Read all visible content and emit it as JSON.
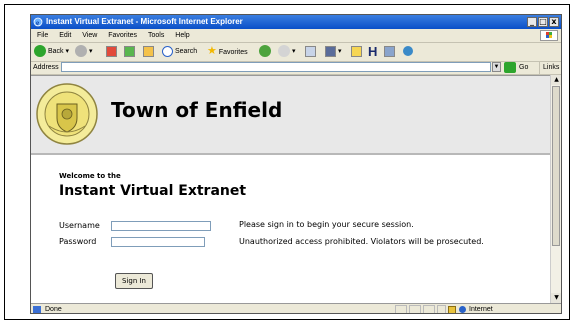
{
  "window": {
    "title": "Instant Virtual Extranet - Microsoft Internet Explorer"
  },
  "menu": {
    "items": [
      "File",
      "Edit",
      "View",
      "Favorites",
      "Tools",
      "Help"
    ]
  },
  "toolbar": {
    "back": "Back",
    "search": "Search",
    "favorites": "Favorites"
  },
  "address": {
    "label": "Address",
    "value": "",
    "go": "Go",
    "links": "Links"
  },
  "page": {
    "town_name": "Town of Enfield",
    "welcome": "Welcome to the",
    "product": "Instant Virtual Extranet",
    "username_label": "Username",
    "password_label": "Password",
    "username_value": "",
    "password_value": "",
    "message_1": "Please sign in to begin your secure session.",
    "message_2": "Unauthorized access prohibited. Violators will be prosecuted.",
    "signin": "Sign In"
  },
  "status": {
    "text": "Done",
    "zone": "Internet"
  }
}
